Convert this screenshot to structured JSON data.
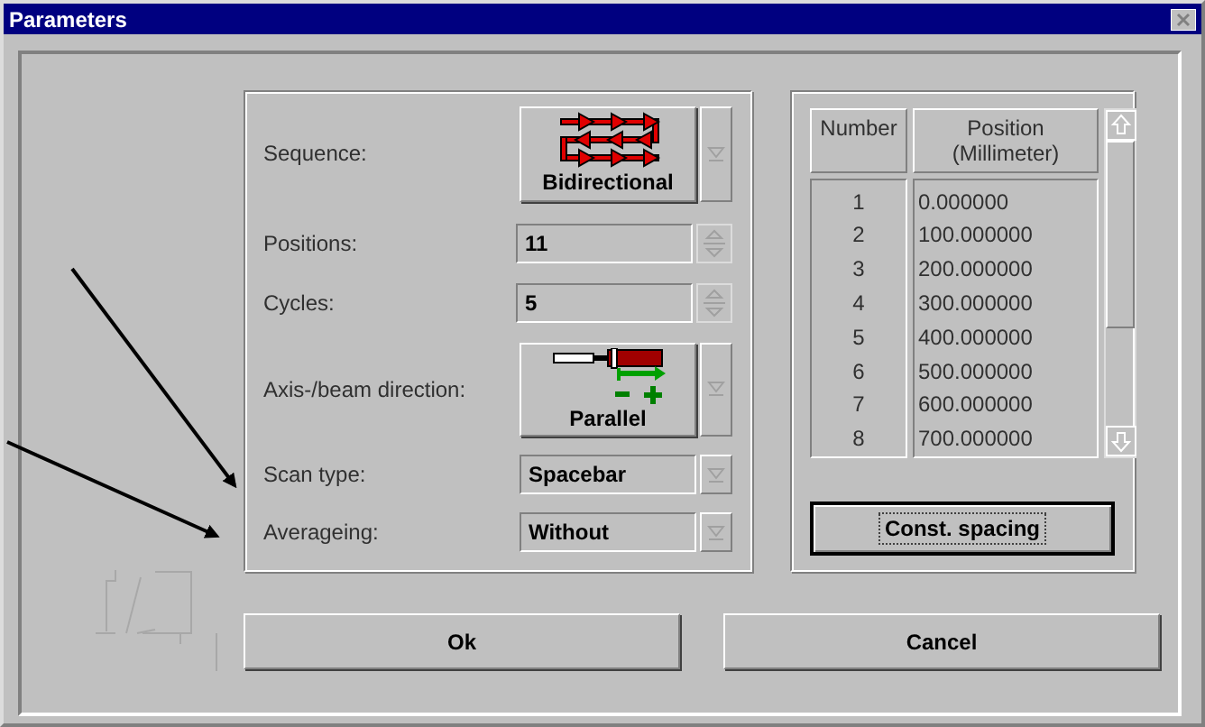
{
  "window": {
    "title": "Parameters"
  },
  "fields": [
    {
      "kind": "sequence-select",
      "label": "Sequence:",
      "value": "Bidirectional"
    },
    {
      "kind": "spin",
      "label": "Positions:",
      "value": "11"
    },
    {
      "kind": "spin",
      "label": "Cycles:",
      "value": "5"
    },
    {
      "kind": "direction-select",
      "label": "Axis-/beam direction:",
      "value": "Parallel"
    },
    {
      "kind": "select",
      "label": "Scan type:",
      "value": "Spacebar"
    },
    {
      "kind": "select",
      "label": "Averageing:",
      "value": "Without"
    }
  ],
  "table": {
    "columns": [
      "Number",
      "Position\n(Millimeter)"
    ],
    "rows": [
      [
        "1",
        "0.000000"
      ],
      [
        "2",
        "100.000000"
      ],
      [
        "3",
        "200.000000"
      ],
      [
        "4",
        "300.000000"
      ],
      [
        "5",
        "400.000000"
      ],
      [
        "6",
        "500.000000"
      ],
      [
        "7",
        "600.000000"
      ],
      [
        "8",
        "700.000000"
      ]
    ]
  },
  "const_button": "Const. spacing",
  "buttons": [
    "Ok",
    "Cancel"
  ]
}
